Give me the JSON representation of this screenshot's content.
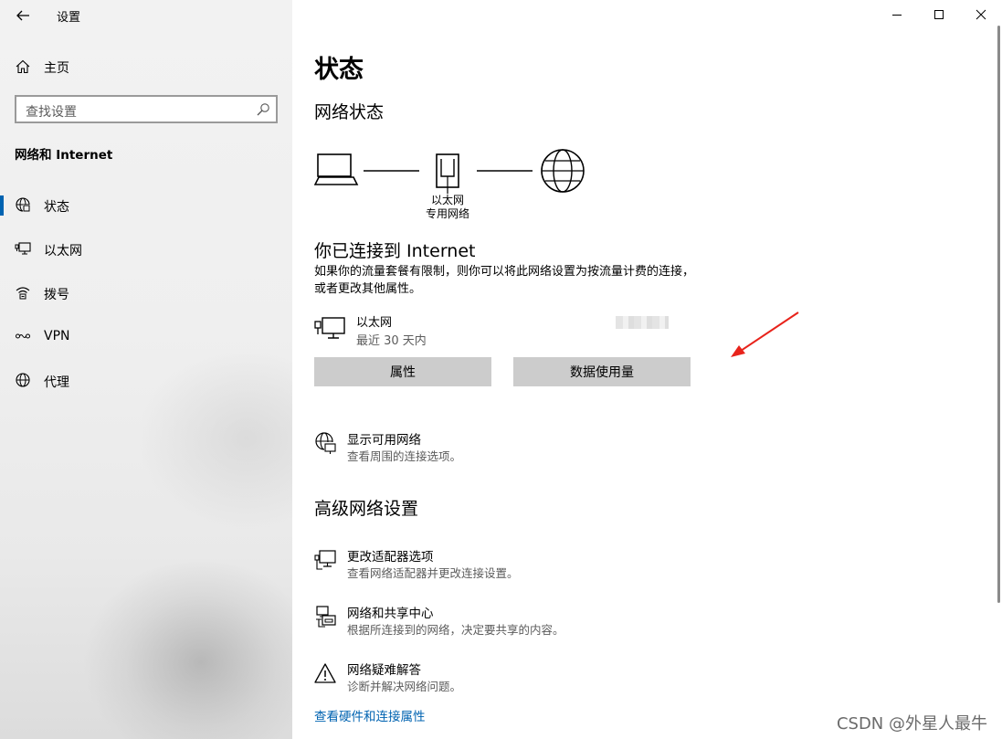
{
  "window": {
    "title": "设置",
    "controls": {
      "minimize": "minimize-icon",
      "maximize": "maximize-icon",
      "close": "close-icon"
    }
  },
  "sidebar": {
    "home_label": "主页",
    "search_placeholder": "查找设置",
    "section_title": "网络和 Internet",
    "items": [
      {
        "label": "状态",
        "icon": "globe-icon",
        "active": true
      },
      {
        "label": "以太网",
        "icon": "ethernet-monitor-icon",
        "active": false
      },
      {
        "label": "拨号",
        "icon": "dialup-icon",
        "active": false
      },
      {
        "label": "VPN",
        "icon": "vpn-icon",
        "active": false
      },
      {
        "label": "代理",
        "icon": "globe-icon",
        "active": false
      }
    ]
  },
  "main": {
    "page_title": "状态",
    "network_status_heading": "网络状态",
    "diagram": {
      "adapter_name": "以太网",
      "network_type": "专用网络"
    },
    "connected_heading": "你已连接到 Internet",
    "metered_text": "如果你的流量套餐有限制，则你可以将此网络设置为按流量计费的连接，或者更改其他属性。",
    "connection": {
      "name": "以太网",
      "usage_period": "最近 30 天内"
    },
    "buttons": {
      "properties": "属性",
      "data_usage": "数据使用量"
    },
    "show_networks": {
      "title": "显示可用网络",
      "subtitle": "查看周围的连接选项。"
    },
    "advanced_heading": "高级网络设置",
    "advanced_items": [
      {
        "title": "更改适配器选项",
        "subtitle": "查看网络适配器并更改连接设置。",
        "icon": "adapter-monitor-icon"
      },
      {
        "title": "网络和共享中心",
        "subtitle": "根据所连接到的网络，决定要共享的内容。",
        "icon": "sharing-center-icon"
      },
      {
        "title": "网络疑难解答",
        "subtitle": "诊断并解决网络问题。",
        "icon": "warning-icon"
      }
    ],
    "hardware_link": "查看硬件和连接属性"
  },
  "watermark": "CSDN @外星人最牛",
  "colors": {
    "accent": "#0063b1",
    "button_bg": "#cccccc",
    "annotation_arrow": "#e8231b"
  }
}
